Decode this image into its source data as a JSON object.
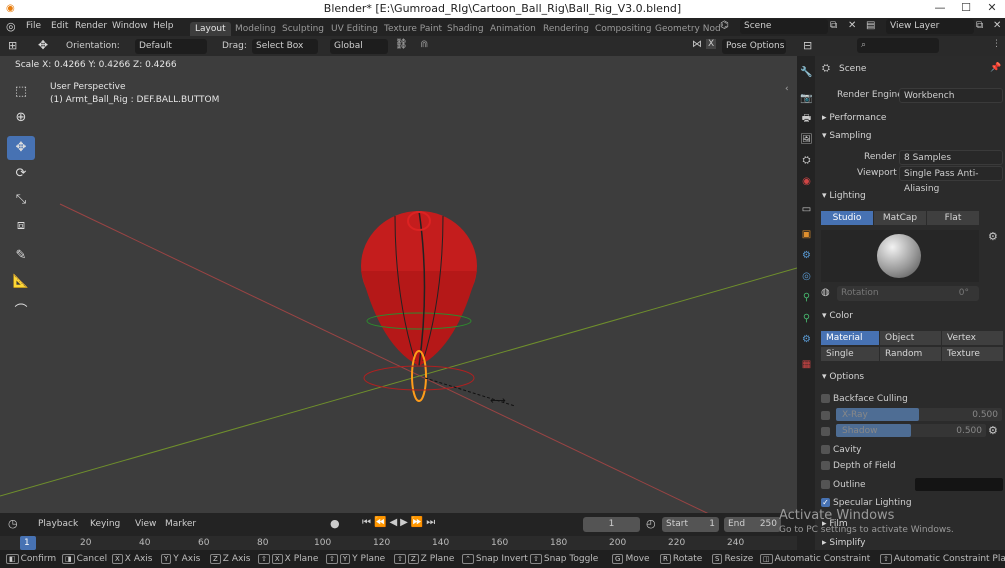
{
  "window": {
    "title": "Blender* [E:\\Gumroad_RIg\\Cartoon_Ball_Rig\\Ball_Rig_V3.0.blend]",
    "minimize": "—",
    "maximize": "☐",
    "close": "✕"
  },
  "menu": {
    "items": [
      "File",
      "Edit",
      "Render",
      "Window",
      "Help"
    ]
  },
  "workspaces": {
    "tabs": [
      "Layout",
      "Modeling",
      "Sculpting",
      "UV Editing",
      "Texture Paint",
      "Shading",
      "Animation",
      "Rendering",
      "Compositing",
      "Geometry Nod"
    ],
    "active": "Layout"
  },
  "scene_selector": {
    "label": "Scene"
  },
  "view_layer": {
    "label": "View Layer"
  },
  "header": {
    "orientation_label": "Orientation:",
    "orientation_value": "Default",
    "drag_label": "Drag:",
    "drag_value": "Select Box",
    "transform_value": "Global",
    "pose_options": "Pose Options"
  },
  "viewport": {
    "scale_readout": "Scale X: 0.4266  Y: 0.4266  Z: 0.4266",
    "perspective": "User Perspective",
    "object_info": "(1) Armt_Ball_Rig : DEF.BALL.BUTTOM"
  },
  "properties": {
    "context": "Scene",
    "render_engine_label": "Render Engine",
    "render_engine": "Workbench",
    "performance": "Performance",
    "sampling": "Sampling",
    "render_label": "Render",
    "render_samples": "8 Samples",
    "viewport_label": "Viewport",
    "viewport_aa": "Single Pass Anti-Aliasing",
    "lighting": "Lighting",
    "lighting_modes": [
      "Studio",
      "MatCap",
      "Flat"
    ],
    "rotation_label": "Rotation",
    "rotation_value": "0°",
    "color": "Color",
    "color_modes": [
      "Material",
      "Object",
      "Vertex",
      "Single",
      "Random",
      "Texture"
    ],
    "options": "Options",
    "backface": "Backface Culling",
    "xray": "X-Ray",
    "xray_value": "0.500",
    "shadow": "Shadow",
    "shadow_value": "0.500",
    "cavity": "Cavity",
    "dof": "Depth of Field",
    "outline": "Outline",
    "specular": "Specular Lighting",
    "film": "Film",
    "simplify": "Simplify"
  },
  "timeline": {
    "playback": "Playback",
    "keying": "Keying",
    "view": "View",
    "marker": "Marker",
    "current_frame": "1",
    "start_label": "Start",
    "start": "1",
    "end_label": "End",
    "end": "250",
    "ruler": [
      "1",
      "20",
      "40",
      "60",
      "80",
      "100",
      "120",
      "140",
      "160",
      "180",
      "200",
      "220",
      "240"
    ]
  },
  "status": {
    "items": [
      {
        "key": "",
        "label": "Confirm"
      },
      {
        "key": "",
        "label": "Cancel"
      },
      {
        "key": "X",
        "label": "X Axis"
      },
      {
        "key": "Y",
        "label": "Y Axis"
      },
      {
        "key": "Z",
        "label": "Z Axis"
      },
      {
        "key": "X",
        "label": "X Plane"
      },
      {
        "key": "Y",
        "label": "Y Plane"
      },
      {
        "key": "Z",
        "label": "Z Plane"
      },
      {
        "key": "",
        "label": "Snap Invert"
      },
      {
        "key": "",
        "label": "Snap Toggle"
      },
      {
        "key": "G",
        "label": "Move"
      },
      {
        "key": "R",
        "label": "Rotate"
      },
      {
        "key": "S",
        "label": "Resize"
      },
      {
        "key": "",
        "label": "Automatic Constraint"
      },
      {
        "key": "",
        "label": "Automatic Constraint Plane"
      }
    ]
  },
  "watermark": {
    "line1": "Activate Windows",
    "line2": "Go to PC settings to activate Windows."
  }
}
